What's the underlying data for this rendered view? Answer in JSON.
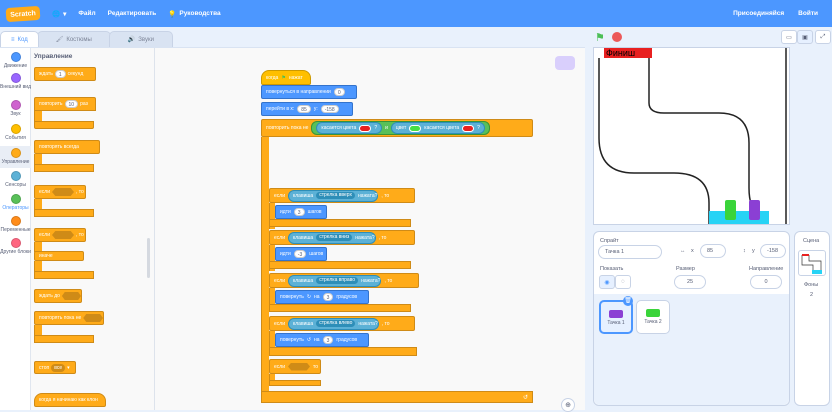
{
  "menubar": {
    "logo": "Scratch",
    "items": [
      "Файл",
      "Редактировать",
      "Руководства"
    ],
    "join": "Присоединяйся",
    "signin": "Войти"
  },
  "tabs": {
    "code": "Код",
    "costumes": "Костюмы",
    "sounds": "Звуки"
  },
  "categories": [
    {
      "label": "Движение",
      "color": "#4c97ff"
    },
    {
      "label": "Внешний вид",
      "color": "#9966ff"
    },
    {
      "label": "Звук",
      "color": "#cf63cf"
    },
    {
      "label": "События",
      "color": "#ffbf00"
    },
    {
      "label": "Управление",
      "color": "#ffab19"
    },
    {
      "label": "Сенсоры",
      "color": "#5cb1d6"
    },
    {
      "label": "Операторы",
      "color": "#59c059"
    },
    {
      "label": "Переменные",
      "color": "#ff8c1a"
    },
    {
      "label": "Другие блоки",
      "color": "#ff6680"
    }
  ],
  "palette": {
    "title": "Управление",
    "wait": "ждать",
    "wait_val": "1",
    "wait_unit": "секунд",
    "repeat": "повторить",
    "repeat_val": "10",
    "repeat_unit": "раз",
    "forever": "повторять всегда",
    "if1": "если",
    "then1": ", то",
    "if2": "если",
    "then2": ", то",
    "else": "иначе",
    "wait_until": "ждать до",
    "repeat_until": "повторять пока не",
    "stop": "стоп",
    "stop_opt": "все",
    "clone": "когда я начинаю как клон"
  },
  "script": {
    "hat": "когда",
    "hat_tail": "нажат",
    "point": "повернуться в направлении",
    "point_val": "0",
    "goto": "перейти в x:",
    "goto_x": "85",
    "goto_y_lbl": "y:",
    "goto_y": "-158",
    "repeat_until": "повторить пока не",
    "touching_color": "касается цвета",
    "q1": "?",
    "and": "и",
    "color": "цвет",
    "touching_color2": "касается цвета",
    "q2": "?",
    "if": "если",
    "key": "клавиша",
    "then": ", то",
    "pressed": "нажата?",
    "key_up": "стрелка вверх",
    "key_down": "стрелка вниз",
    "key_right": "стрелка вправо",
    "key_left": "стрелка влево",
    "move": "идти",
    "move_up": "3",
    "move_down": "-3",
    "steps": "шагов",
    "turn_right": "повернуть",
    "turn_on": "на",
    "turn_val_r": "3",
    "turn_val_l": "3",
    "degrees": "градусов",
    "if_empty": "если",
    "then_empty": "то"
  },
  "stage": {
    "finish": "Финиш"
  },
  "sprite": {
    "label": "Спрайт",
    "name": "Тачка 1",
    "x_lbl": "x",
    "x": "85",
    "y_lbl": "y",
    "y": "-158",
    "show": "Показать",
    "size_lbl": "Размер",
    "size": "25",
    "dir_lbl": "Направление",
    "dir": "0",
    "thumbs": [
      "Тачка 1",
      "Тачка 2"
    ]
  },
  "stage_panel": {
    "title": "Сцена",
    "backdrops": "Фоны",
    "count": "2"
  }
}
